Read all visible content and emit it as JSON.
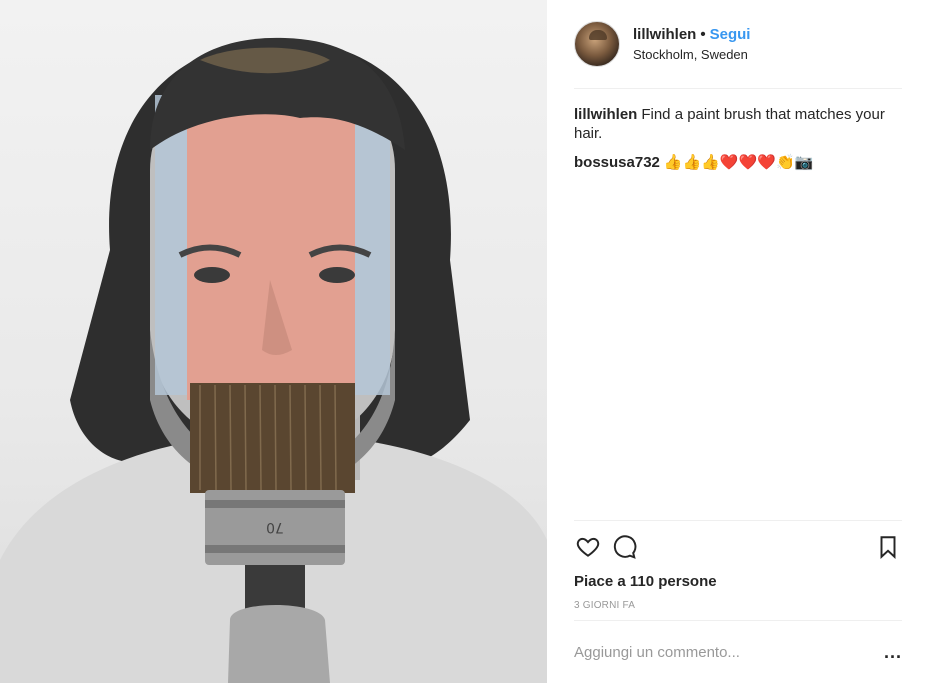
{
  "post": {
    "username": "lillwihlen",
    "separator": "•",
    "follow_label": "Segui",
    "location": "Stockholm, Sweden",
    "avatar_icon": "user-avatar",
    "comments": [
      {
        "user": "lillwihlen",
        "text": "Find a paint brush that matches your hair."
      },
      {
        "user": "bossusa732",
        "text": "👍👍👍❤️❤️❤️👏📷"
      }
    ],
    "likes_text": "Piace a 110 persone",
    "timestamp": "3 GIORNI FA",
    "comment_placeholder": "Aggiungi un commento...",
    "more_label": "...",
    "icons": {
      "like": "heart-icon",
      "comment": "speech-bubble-icon",
      "save": "bookmark-icon"
    },
    "brush_marking": "70",
    "colors": {
      "follow": "#3897f0",
      "pink_band": "#e79a88",
      "blue_band": "#b4c6d6"
    }
  }
}
